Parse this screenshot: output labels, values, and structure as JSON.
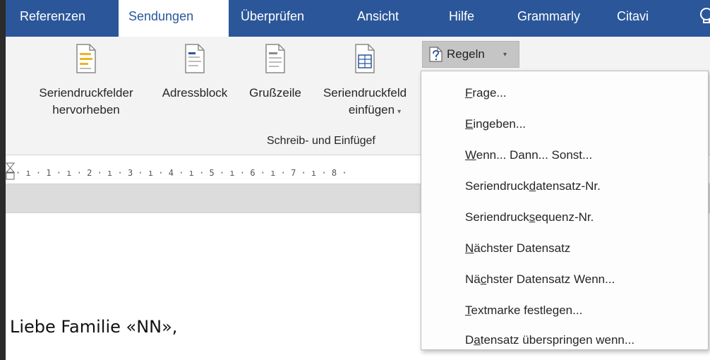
{
  "tabs": [
    {
      "label": "Referenzen",
      "active": false
    },
    {
      "label": "Sendungen",
      "active": true
    },
    {
      "label": "Überprüfen",
      "active": false
    },
    {
      "label": "Ansicht",
      "active": false
    },
    {
      "label": "Hilfe",
      "active": false
    },
    {
      "label": "Grammarly",
      "active": false
    },
    {
      "label": "Citavi",
      "active": false
    }
  ],
  "ribbon": {
    "buttons": [
      {
        "line1": "Seriendruckfelder",
        "line2": "hervorheben",
        "icon": "highlight-fields-icon"
      },
      {
        "line1": "Adressblock",
        "line2": "",
        "icon": "address-block-icon"
      },
      {
        "line1": "Grußzeile",
        "line2": "",
        "icon": "greeting-line-icon"
      },
      {
        "line1": "Seriendruckfeld",
        "line2": "einfügen",
        "icon": "insert-merge-field-icon"
      }
    ],
    "group_label": "Schreib- und Einfügef",
    "rules_button": "Regeln",
    "rules_icon": "rules-question-icon"
  },
  "ruler": {
    "text": "· ı · 1 · ı · 2 · ı · 3 · ı · 4 · ı · 5 · ı · 6 · ı · 7 · ı · 8 ·"
  },
  "document": {
    "greeting": "Liebe Familie «NN»,"
  },
  "menu": {
    "items": [
      {
        "pre": "",
        "ul": "F",
        "post": "rage..."
      },
      {
        "pre": "",
        "ul": "E",
        "post": "ingeben..."
      },
      {
        "pre": "",
        "ul": "W",
        "post": "enn... Dann... Sonst..."
      },
      {
        "pre": "Seriendruck",
        "ul": "d",
        "post": "atensatz-Nr."
      },
      {
        "pre": "Seriendruck",
        "ul": "s",
        "post": "equenz-Nr."
      },
      {
        "pre": "",
        "ul": "N",
        "post": "ächster Datensatz"
      },
      {
        "pre": "Nä",
        "ul": "c",
        "post": "hster Datensatz Wenn..."
      },
      {
        "pre": "",
        "ul": "T",
        "post": "extmarke festlegen..."
      },
      {
        "pre": "D",
        "ul": "a",
        "post": "tensatz überspringen wenn..."
      }
    ]
  },
  "colors": {
    "tabbar": "#2b579a",
    "ribbon": "#f3f3f3",
    "active_tab_text": "#2b579a"
  }
}
